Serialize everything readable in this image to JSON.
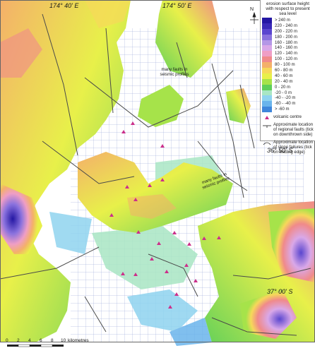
{
  "legend": {
    "title": "erosion surface height with respect to present sea level",
    "ramp": [
      {
        "label": "> 240 m",
        "color": "#2417a3"
      },
      {
        "label": "220 - 240 m",
        "color": "#3a2ab8"
      },
      {
        "label": "200 - 220 m",
        "color": "#5a46cf"
      },
      {
        "label": "180 - 200 m",
        "color": "#8a72de"
      },
      {
        "label": "160 - 180 m",
        "color": "#b497e6"
      },
      {
        "label": "140 - 160 m",
        "color": "#d9a8e8"
      },
      {
        "label": "120 - 140 m",
        "color": "#ef9ec5"
      },
      {
        "label": "100 - 120 m",
        "color": "#f08a8a"
      },
      {
        "label": "80 - 100 m",
        "color": "#f4b06a"
      },
      {
        "label": "60 - 80 m",
        "color": "#f6d85a"
      },
      {
        "label": "40 - 60 m",
        "color": "#e8f04a"
      },
      {
        "label": "20 - 40 m",
        "color": "#a6e34a"
      },
      {
        "label": "0 - 20 m",
        "color": "#5fcf5a"
      },
      {
        "label": "-20 - 0 m",
        "color": "#a9e6c4"
      },
      {
        "label": "-40 - -20 m",
        "color": "#8fd3ef"
      },
      {
        "label": "-60 - -40 m",
        "color": "#6ab4ec"
      },
      {
        "label": "> -60 m",
        "color": "#3f86db"
      }
    ],
    "volcanic": "volcanic centre",
    "faults": "Approximate location of regional faults (tick on downthrown side)",
    "slope": "Approximate location of slope failures (tick on leading edge)"
  },
  "coords": {
    "lon1": "174° 40' E",
    "lon2": "174° 50' E",
    "lat1": "36° 50' S",
    "lat2": "37° 00' S"
  },
  "annotations": {
    "faults_profiles": "many faults in seismic profiles",
    "faults_profiles2": "many faults in seismic profiles"
  },
  "north": "N",
  "scale": {
    "ticks": [
      "0",
      "2",
      "4",
      "6",
      "8",
      "10"
    ],
    "unit": "kilometres"
  },
  "colors": {
    "land_low": "#5fcf5a",
    "land_mid": "#e8f04a",
    "land_high": "#f4b06a",
    "peak": "#2417a3",
    "sea": "#ffffff",
    "grid": "#8a9ed6",
    "fault": "#4a4a4a",
    "volcano": "#cc2f8a"
  }
}
